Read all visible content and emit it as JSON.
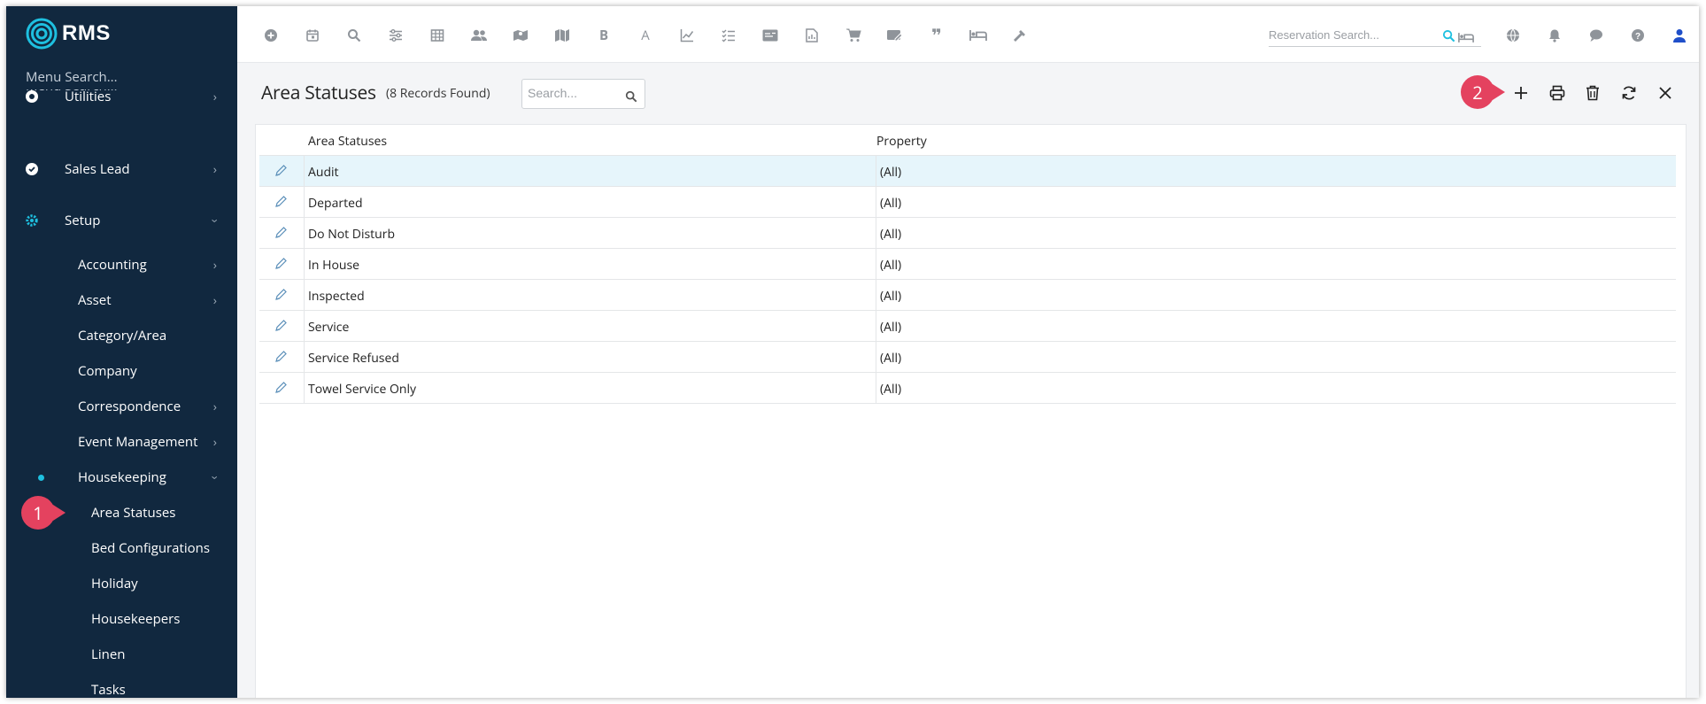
{
  "app": {
    "logo_text": "RMS",
    "accent": "#1ec0e0",
    "sidebar_bg": "#11283f",
    "callout_color": "#e4425f"
  },
  "sidebar": {
    "menu_search": "Menu Search...",
    "items": [
      {
        "label": "Utilities",
        "icon": "utilities-icon"
      },
      {
        "label": "Sales Lead",
        "icon": "check-circle-icon"
      },
      {
        "label": "Setup",
        "icon": "gear-icon"
      }
    ],
    "setup_children": [
      {
        "label": "Accounting"
      },
      {
        "label": "Asset"
      },
      {
        "label": "Category/Area"
      },
      {
        "label": "Company"
      },
      {
        "label": "Correspondence"
      },
      {
        "label": "Event Management"
      },
      {
        "label": "Housekeeping"
      }
    ],
    "housekeeping_children": [
      {
        "label": "Area Statuses"
      },
      {
        "label": "Bed Configurations"
      },
      {
        "label": "Holiday"
      },
      {
        "label": "Housekeepers"
      },
      {
        "label": "Linen"
      },
      {
        "label": "Tasks"
      }
    ]
  },
  "callouts": {
    "one": "1",
    "two": "2"
  },
  "toolbar": {
    "icons": [
      "add-circle-icon",
      "calendar-icon",
      "search-icon",
      "sliders-icon",
      "table-icon",
      "guests-icon",
      "map-pin-icon",
      "map-icon",
      "bold-b-icon",
      "letter-a-icon",
      "line-chart-icon",
      "checklist-icon",
      "id-card-icon",
      "report-icon",
      "cart-icon",
      "payment-icon",
      "quote-icon",
      "bed-icon",
      "hammer-icon"
    ],
    "reservation_search_placeholder": "Reservation Search...",
    "right_icons": [
      "globe-icon",
      "bell-icon",
      "chat-icon",
      "help-icon",
      "user-icon"
    ]
  },
  "page": {
    "title": "Area Statuses",
    "record_count": "(8 Records Found)",
    "search_placeholder": "Search..."
  },
  "grid": {
    "columns": [
      "Area Statuses",
      "Property"
    ],
    "rows": [
      {
        "name": "Audit",
        "property": "(All)"
      },
      {
        "name": "Departed",
        "property": "(All)"
      },
      {
        "name": "Do Not Disturb",
        "property": "(All)"
      },
      {
        "name": "In House",
        "property": "(All)"
      },
      {
        "name": "Inspected",
        "property": "(All)"
      },
      {
        "name": "Service",
        "property": "(All)"
      },
      {
        "name": "Service Refused",
        "property": "(All)"
      },
      {
        "name": "Towel Service Only",
        "property": "(All)"
      }
    ]
  }
}
